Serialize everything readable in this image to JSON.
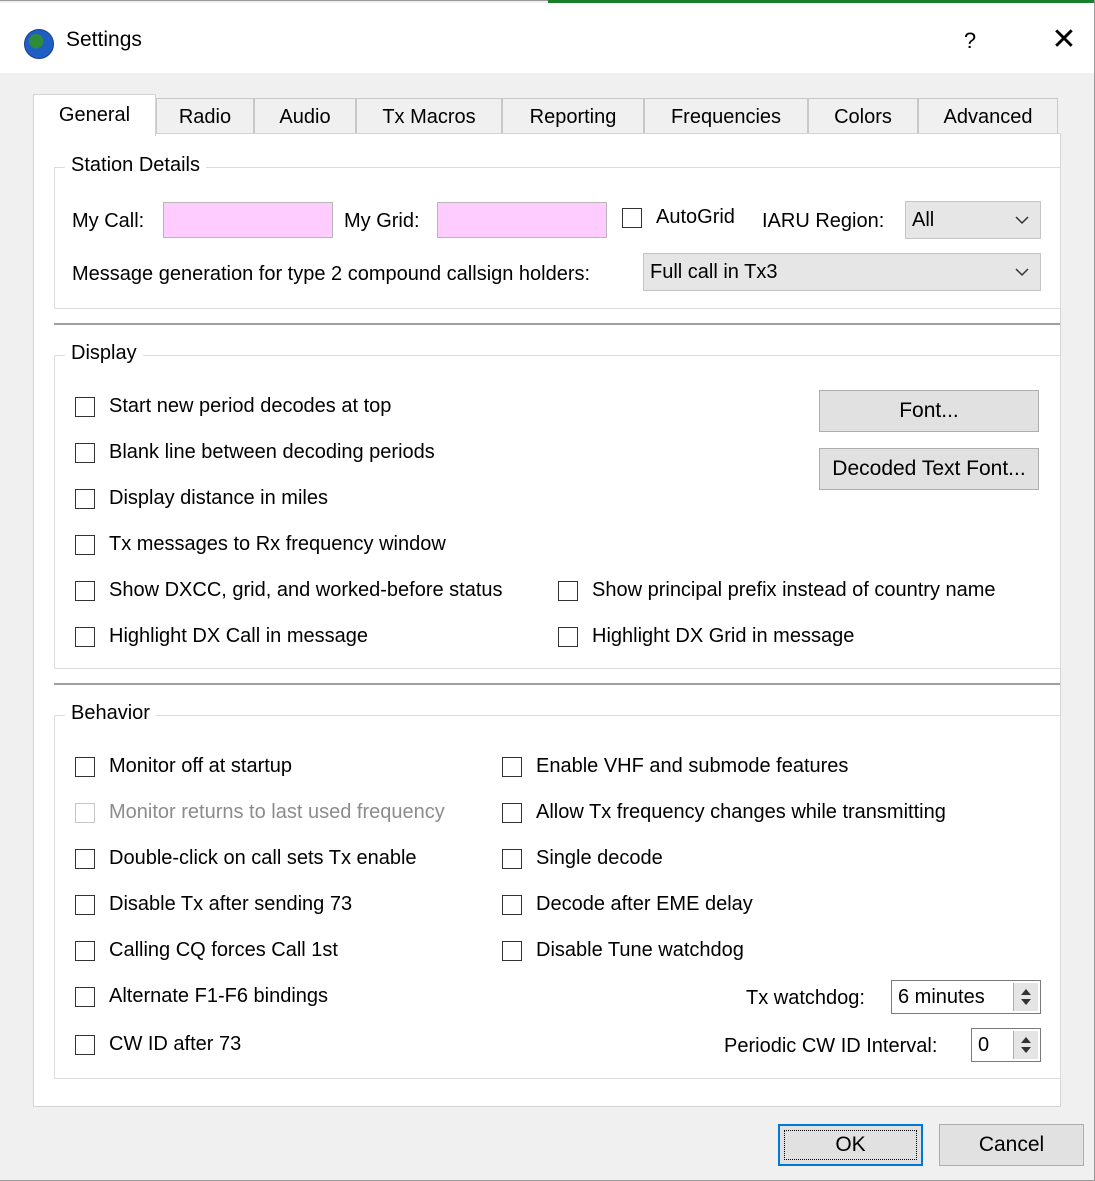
{
  "window": {
    "title": "Settings",
    "help_glyph": "?",
    "close_glyph": "✕"
  },
  "tabs": [
    {
      "label": "General",
      "active": true
    },
    {
      "label": "Radio",
      "active": false
    },
    {
      "label": "Audio",
      "active": false
    },
    {
      "label": "Tx Macros",
      "active": false
    },
    {
      "label": "Reporting",
      "active": false
    },
    {
      "label": "Frequencies",
      "active": false
    },
    {
      "label": "Colors",
      "active": false
    },
    {
      "label": "Advanced",
      "active": false
    }
  ],
  "station": {
    "legend": "Station Details",
    "my_call_label": "My Call:",
    "my_call_value": "",
    "my_grid_label": "My Grid:",
    "my_grid_value": "",
    "autogrid_label": "AutoGrid",
    "iaru_label": "IARU Region:",
    "iaru_value": "All",
    "msg_gen_label": "Message generation for type 2 compound callsign holders:",
    "msg_gen_value": "Full call in Tx3"
  },
  "display": {
    "legend": "Display",
    "checks": [
      "Start new period decodes at top",
      "Blank line between decoding periods",
      "Display distance in miles",
      "Tx messages to Rx frequency window",
      "Show DXCC, grid, and worked-before status",
      "Highlight DX Call in message"
    ],
    "right_checks": [
      "Show principal prefix instead of country name",
      "Highlight DX Grid in message"
    ],
    "font_button": "Font...",
    "decoded_font_button": "Decoded Text Font..."
  },
  "behavior": {
    "legend": "Behavior",
    "left_checks": [
      {
        "label": "Monitor off at startup",
        "disabled": false
      },
      {
        "label": "Monitor returns to last used frequency",
        "disabled": true
      },
      {
        "label": "Double-click on call sets Tx enable",
        "disabled": false
      },
      {
        "label": "Disable Tx after sending 73",
        "disabled": false
      },
      {
        "label": "Calling CQ forces Call 1st",
        "disabled": false
      },
      {
        "label": "Alternate F1-F6 bindings",
        "disabled": false
      },
      {
        "label": "CW ID after 73",
        "disabled": false
      }
    ],
    "right_checks": [
      "Enable VHF and submode features",
      "Allow Tx frequency changes while transmitting",
      "Single decode",
      "Decode after EME delay",
      "Disable Tune watchdog"
    ],
    "tx_watchdog_label": "Tx watchdog:",
    "tx_watchdog_value": "6 minutes",
    "cw_interval_label": "Periodic CW ID Interval:",
    "cw_interval_value": "0"
  },
  "buttons": {
    "ok": "OK",
    "cancel": "Cancel"
  },
  "colors": {
    "input_bg": "#ffccff",
    "accent": "#0078d7"
  }
}
